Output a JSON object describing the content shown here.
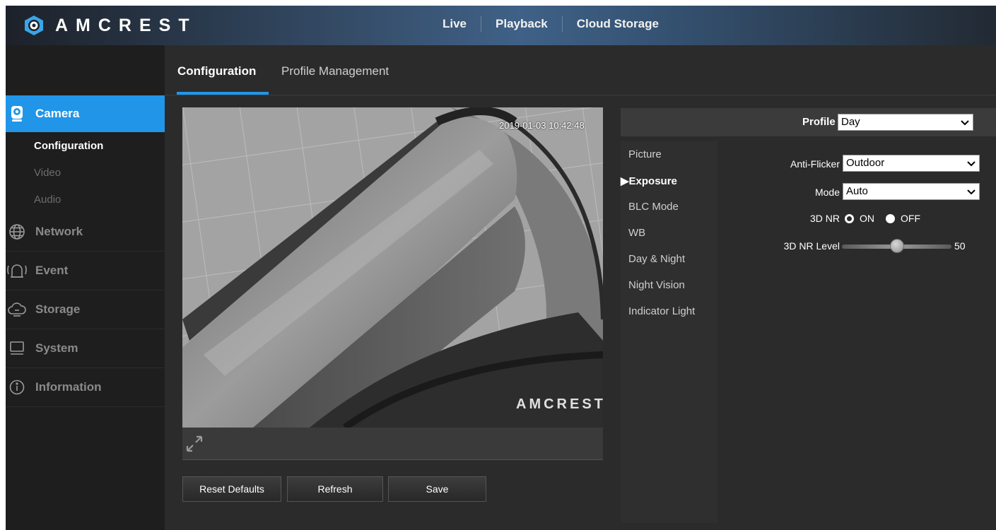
{
  "header": {
    "logo_text": "AMCREST",
    "nav": [
      "Live",
      "Playback",
      "Cloud Storage"
    ]
  },
  "sidebar": {
    "sections": [
      {
        "label": "Camera",
        "icon": "camera-icon",
        "active": true
      },
      {
        "label": "Network",
        "icon": "network-globe-icon"
      },
      {
        "label": "Event",
        "icon": "alarm-icon"
      },
      {
        "label": "Storage",
        "icon": "cloud-storage-icon"
      },
      {
        "label": "System",
        "icon": "monitor-icon"
      },
      {
        "label": "Information",
        "icon": "info-icon"
      }
    ],
    "camera_subitems": [
      "Configuration",
      "Video",
      "Audio"
    ]
  },
  "tabs": [
    "Configuration",
    "Profile Management"
  ],
  "video": {
    "timestamp": "2019-01-03 10:42:48",
    "watermark": "AMCREST"
  },
  "buttons": {
    "reset": "Reset Defaults",
    "refresh": "Refresh",
    "save": "Save"
  },
  "profile": {
    "label": "Profile",
    "value": "Day"
  },
  "menu": [
    "Picture",
    "Exposure",
    "BLC Mode",
    "WB",
    "Day & Night",
    "Night Vision",
    "Indicator Light"
  ],
  "menu_active": "Exposure",
  "exposure": {
    "anti_flicker_label": "Anti-Flicker",
    "anti_flicker_value": "Outdoor",
    "mode_label": "Mode",
    "mode_value": "Auto",
    "nr3d_label": "3D NR",
    "nr3d_on": "ON",
    "nr3d_off": "OFF",
    "nr3d_selected": "ON",
    "nr3d_level_label": "3D NR Level",
    "nr3d_level_value": "50",
    "nr3d_level_fraction": 0.5
  },
  "colors": {
    "accent": "#2196e8",
    "sidebar_bg": "#1e1e1e",
    "main_bg": "#2b2b2b"
  }
}
